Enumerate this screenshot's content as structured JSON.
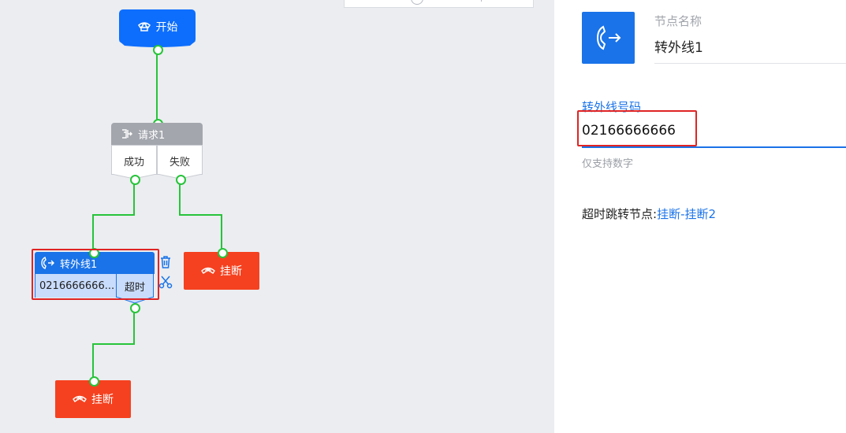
{
  "flow": {
    "start": {
      "label": "开始",
      "icon": "phone-icon"
    },
    "request": {
      "title": "请求1",
      "icon": "request-icon",
      "branches": [
        "成功",
        "失败"
      ]
    },
    "transfer": {
      "title": "转外线1",
      "icon": "phone-forward-icon",
      "number": "0216666666...",
      "timeout_label": "超时"
    },
    "hangup_right": {
      "label": "挂断",
      "icon": "hangup-icon"
    },
    "hangup_bottom": {
      "label": "挂断",
      "icon": "hangup-icon"
    },
    "tools": [
      "trash-icon",
      "scissors-icon"
    ],
    "colors": {
      "start": "#0d6efd",
      "request": "#a3a6ad",
      "transfer": "#1a73e8",
      "hangup": "#f5411f",
      "wire": "#27c43a",
      "highlight": "#e02424"
    }
  },
  "panel": {
    "icon": "phone-forward-icon",
    "node_name_label": "节点名称",
    "node_name_value": "转外线1",
    "number_label": "转外线号码",
    "number_value": "02166666666",
    "hint": "仅支持数字",
    "timeout_label": "超时跳转节点:",
    "timeout_value": "挂断-挂断2"
  }
}
